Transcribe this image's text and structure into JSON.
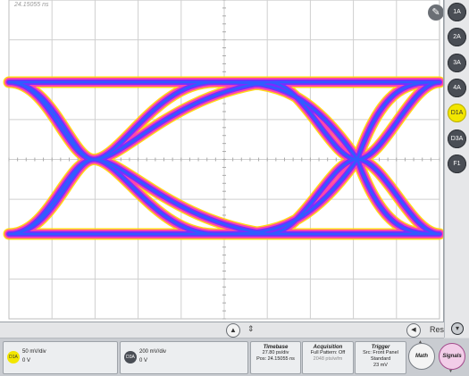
{
  "scope": {
    "position_label": "24.15055 ns",
    "colors": {
      "grid": "#cfcfcf",
      "eye_outer": "#ffd400",
      "eye_mid": "#ff3cb4",
      "eye_core": "#7a2cff",
      "eye_center": "#2f5dff",
      "background": "#ffffff"
    }
  },
  "sidebar": {
    "buttons": [
      {
        "label": "1A",
        "active": false
      },
      {
        "label": "2A",
        "active": false
      },
      {
        "label": "3A",
        "active": false
      },
      {
        "label": "4A",
        "active": false
      },
      {
        "label": "D1A",
        "active": true
      },
      {
        "label": "D3A",
        "active": false
      },
      {
        "label": "F1",
        "active": false
      }
    ],
    "scroll_down_icon": "chevron-down-icon"
  },
  "midbar": {
    "up_icon": "▲",
    "marker_icon": "⇕",
    "left_icon": "◀",
    "res_label": "Res"
  },
  "channels": [
    {
      "badge": "D1A",
      "scale": "50 mV/div",
      "offset": "0 V",
      "color": "#f2e600",
      "text_color": "#333"
    },
    {
      "badge": "D3A",
      "scale": "200 mV/div",
      "offset": "0 V",
      "color": "#4a4e55",
      "text_color": "#ffffff"
    }
  ],
  "timebase": {
    "title": "Timebase",
    "scale": "27.80 ps/div",
    "position": "Pos: 24.15055 ns"
  },
  "acquisition": {
    "title": "Acquisition",
    "mode": "Full Pattern: Off",
    "rate": "2048 pts/wfm"
  },
  "trigger": {
    "title": "Trigger",
    "source": "Src: Front Panel",
    "mode": "Standard",
    "level": "23 mV"
  },
  "buttons": {
    "math": "Math",
    "signals": "Signals"
  }
}
